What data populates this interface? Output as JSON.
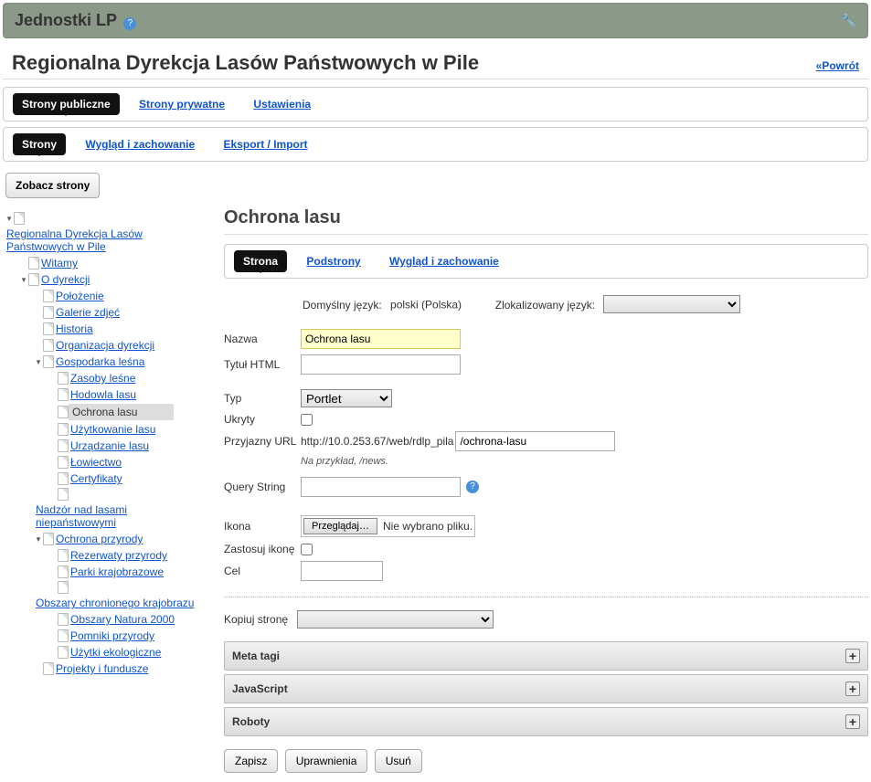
{
  "header": {
    "title": "Jednostki LP"
  },
  "page": {
    "title": "Regionalna Dyrekcja Lasów Państwowych w Pile",
    "return_label": "«Powrót"
  },
  "tabs_primary": {
    "public": "Strony publiczne",
    "private": "Strony prywatne",
    "settings": "Ustawienia"
  },
  "tabs_secondary": {
    "pages": "Strony",
    "look": "Wygląd i zachowanie",
    "export": "Eksport / Import"
  },
  "view_btn": "Zobacz strony",
  "tree": {
    "root": "Regionalna Dyrekcja Lasów Państwowych w Pile",
    "welcome": "Witamy",
    "about": "O dyrekcji",
    "location": "Położenie",
    "gallery": "Galerie zdjęć",
    "history": "Historia",
    "org": "Organizacja dyrekcji",
    "forestry": "Gospodarka leśna",
    "resources": "Zasoby leśne",
    "breeding": "Hodowla lasu",
    "protection": "Ochrona lasu",
    "use": "Użytkowanie lasu",
    "arrange": "Urządzanie lasu",
    "hunting": "Łowiectwo",
    "certs": "Certyfikaty",
    "supervision": "Nadzór nad lasami niepaństwowymi",
    "nature": "Ochrona przyrody",
    "reserves": "Rezerwaty przyrody",
    "parks": "Parki krajobrazowe",
    "protected": "Obszary chronionego krajobrazu",
    "natura": "Obszary Natura 2000",
    "monuments": "Pomniki przyrody",
    "ecological": "Użytki ekologiczne",
    "projects": "Projekty i fundusze"
  },
  "content": {
    "title": "Ochrona lasu",
    "tabs": {
      "page": "Strona",
      "children": "Podstrony",
      "look": "Wygląd i zachowanie"
    },
    "default_lang_label": "Domyślny język:",
    "default_lang_value": "polski (Polska)",
    "localized_lang_label": "Zlokalizowany język:",
    "labels": {
      "name": "Nazwa",
      "html_title": "Tytuł HTML",
      "type": "Typ",
      "hidden": "Ukryty",
      "friendly_url": "Przyjazny URL",
      "example": "Na przykład, /news.",
      "query": "Query String",
      "icon": "Ikona",
      "apply_icon": "Zastosuj ikonę",
      "target": "Cel",
      "copy": "Kopiuj stronę"
    },
    "values": {
      "name": "Ochrona lasu",
      "type": "Portlet",
      "url_prefix": "http://10.0.253.67/web/rdlp_pila",
      "url_path": "/ochrona-lasu",
      "file_btn": "Przeglądaj…",
      "file_none": "Nie wybrano pliku."
    },
    "panels": {
      "meta": "Meta tagi",
      "js": "JavaScript",
      "robots": "Roboty"
    },
    "actions": {
      "save": "Zapisz",
      "perms": "Uprawnienia",
      "delete": "Usuń"
    }
  }
}
